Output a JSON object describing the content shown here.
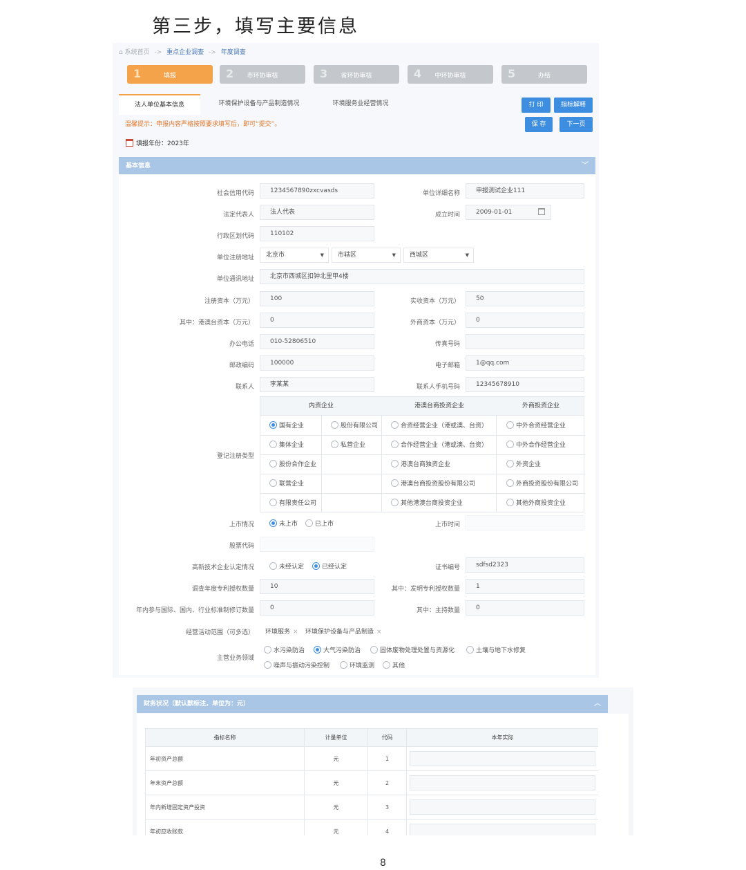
{
  "doc": {
    "heading": "第三步，填写主要信息",
    "page_number": "8"
  },
  "breadcrumb": {
    "home": "系统首页",
    "sep": "->",
    "level1": "重点企业调查",
    "level2": "年度调查"
  },
  "steps": [
    {
      "num": "1",
      "label": "填报"
    },
    {
      "num": "2",
      "label": "市环协审核"
    },
    {
      "num": "3",
      "label": "省环协审核"
    },
    {
      "num": "4",
      "label": "中环协审核"
    },
    {
      "num": "5",
      "label": "办结"
    }
  ],
  "tabs": [
    "法人单位基本信息",
    "环境保护设备与产品制造情况",
    "环境服务业经营情况"
  ],
  "buttons": {
    "print": "打 印",
    "explain": "指标解释",
    "save": "保 存",
    "next": "下一页"
  },
  "hint": "温馨提示：申报内容严格按照要求填写后，即可“提交”。",
  "fill_year": {
    "label": "填报年份：2023年"
  },
  "section_basic": {
    "title": "基本信息",
    "chevron": "﹀"
  },
  "fields": {
    "credit_code": {
      "label": "社会信用代码",
      "value": "1234567890zxcvasds"
    },
    "unit_name": {
      "label": "单位详细名称",
      "value": "申报测试企业111"
    },
    "legal_rep": {
      "label": "法定代表人",
      "value": "法人代表"
    },
    "found_date": {
      "label": "成立时间",
      "value": "2009-01-01"
    },
    "region_code": {
      "label": "行政区划代码",
      "value": "110102"
    },
    "reg_address": {
      "label": "单位注册地址",
      "province": "北京市",
      "city": "市辖区",
      "district": "西城区"
    },
    "mail_address": {
      "label": "单位通讯地址",
      "value": "北京市西城区扣钟北里甲4楼"
    },
    "reg_capital": {
      "label": "注册资本（万元）",
      "value": "100"
    },
    "paid_capital": {
      "label": "实收资本（万元）",
      "value": "50"
    },
    "hmt_capital": {
      "label": "其中：港澳台资本（万元）",
      "value": "0"
    },
    "foreign_capital": {
      "label": "外商资本（万元）",
      "value": "0"
    },
    "office_phone": {
      "label": "办公电话",
      "value": "010-52806510"
    },
    "fax": {
      "label": "传真号码",
      "value": ""
    },
    "postcode": {
      "label": "邮政编码",
      "value": "100000"
    },
    "email": {
      "label": "电子邮箱",
      "value": "1@qq.com"
    },
    "contact": {
      "label": "联系人",
      "value": "李某某"
    },
    "contact_mobile": {
      "label": "联系人手机号码",
      "value": "12345678910"
    },
    "reg_type": {
      "label": "登记注册类型",
      "headers": [
        "内资企业",
        "港澳台商投资企业",
        "外商投资企业"
      ],
      "domestic_a": [
        "国有企业",
        "集体企业",
        "股份合作企业",
        "联营企业",
        "有限责任公司"
      ],
      "domestic_b": [
        "股份有限公司",
        "私营企业"
      ],
      "hmt": [
        "合资经营企业（港或澳、台资）",
        "合作经营企业（港或澳、台资）",
        "港澳台商独资企业",
        "港澳台商投资股份有限公司",
        "其他港澳台商投资企业"
      ],
      "foreign": [
        "中外合资经营企业",
        "中外合作经营企业",
        "外资企业",
        "外商投资股份有限公司",
        "其他外商投资企业"
      ]
    },
    "listing": {
      "label": "上市情况",
      "options": [
        "未上市",
        "已上市"
      ],
      "time_label": "上市时间"
    },
    "stock_code": {
      "label": "股票代码"
    },
    "hitech": {
      "label": "高新技术企业认定情况",
      "options": [
        "未经认定",
        "已经认定"
      ]
    },
    "cert_no": {
      "label": "证书编号",
      "value": "sdfsd2323"
    },
    "patents": {
      "label": "调查年度专利授权数量",
      "value": "10"
    },
    "invention_patents": {
      "label": "其中：发明专利授权数量",
      "value": "1"
    },
    "standards": {
      "label": "年内参与国际、国内、行业标准制修订数量",
      "value": "0"
    },
    "lead_standards": {
      "label": "其中：主持数量",
      "value": "0"
    },
    "scope": {
      "label": "经营活动范围（可多选）",
      "tags": [
        "环境服务",
        "环境保护设备与产品制造"
      ],
      "x": "×"
    },
    "main_field": {
      "label": "主营业务领域",
      "options": [
        "水污染防治",
        "大气污染防治",
        "固体废物处理处置与资源化",
        "土壤与地下水修复",
        "噪声与振动污染控制",
        "环境监测",
        "其他"
      ]
    }
  },
  "finance": {
    "title": "财务状况（默认默标注，单位为：元）",
    "chevron": "︿",
    "columns": [
      "指标名称",
      "计量单位",
      "代码",
      "本年实际"
    ],
    "rows": [
      {
        "name": "年初资产总额",
        "unit": "元",
        "code": "1"
      },
      {
        "name": "年末资产总额",
        "unit": "元",
        "code": "2"
      },
      {
        "name": "年内新增固定资产投资",
        "unit": "元",
        "code": "3"
      },
      {
        "name": "年初应收账款",
        "unit": "元",
        "code": "4"
      }
    ]
  },
  "colors": {
    "accent_orange": "#f5a34a",
    "primary_blue": "#3d8ee0",
    "panel_blue": "#a9c6e6"
  }
}
